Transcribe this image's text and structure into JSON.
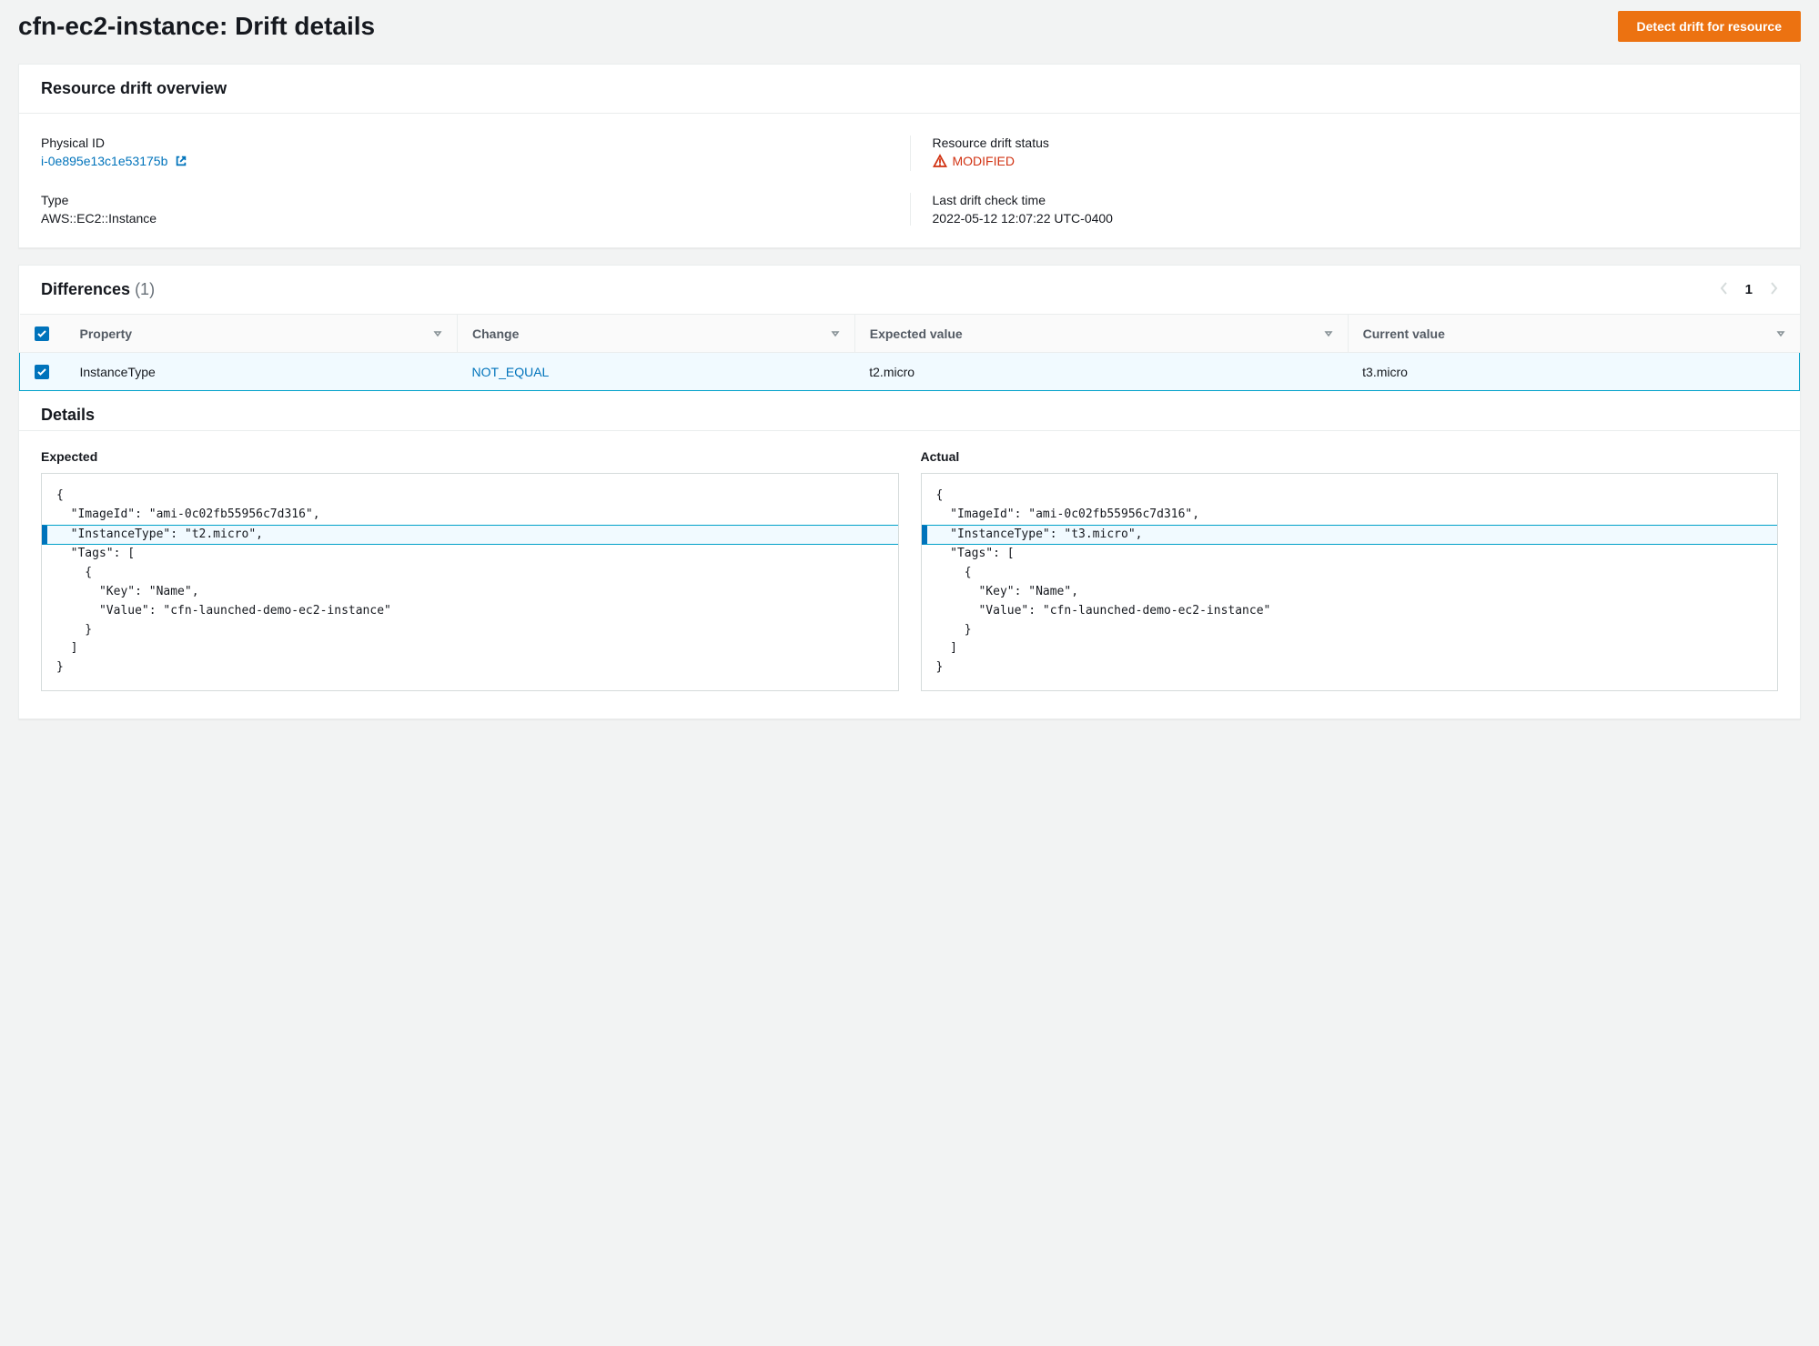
{
  "header": {
    "title": "cfn-ec2-instance: Drift details",
    "detect_button": "Detect drift for resource"
  },
  "overview": {
    "section_title": "Resource drift overview",
    "physical_id_label": "Physical ID",
    "physical_id_value": "i-0e895e13c1e53175b",
    "drift_status_label": "Resource drift status",
    "drift_status_value": "MODIFIED",
    "type_label": "Type",
    "type_value": "AWS::EC2::Instance",
    "last_check_label": "Last drift check time",
    "last_check_value": "2022-05-12 12:07:22 UTC-0400"
  },
  "differences": {
    "section_title": "Differences",
    "count": "(1)",
    "pager_page": "1",
    "columns": {
      "property": "Property",
      "change": "Change",
      "expected": "Expected value",
      "current": "Current value"
    },
    "rows": [
      {
        "property": "InstanceType",
        "change": "NOT_EQUAL",
        "expected": "t2.micro",
        "current": "t3.micro"
      }
    ]
  },
  "details": {
    "section_title": "Details",
    "expected_label": "Expected",
    "actual_label": "Actual",
    "expected_lines": [
      "{",
      "  \"ImageId\": \"ami-0c02fb55956c7d316\",",
      "  \"InstanceType\": \"t2.micro\",",
      "  \"Tags\": [",
      "    {",
      "      \"Key\": \"Name\",",
      "      \"Value\": \"cfn-launched-demo-ec2-instance\"",
      "    }",
      "  ]",
      "}"
    ],
    "actual_lines": [
      "{",
      "  \"ImageId\": \"ami-0c02fb55956c7d316\",",
      "  \"InstanceType\": \"t3.micro\",",
      "  \"Tags\": [",
      "    {",
      "      \"Key\": \"Name\",",
      "      \"Value\": \"cfn-launched-demo-ec2-instance\"",
      "    }",
      "  ]",
      "}"
    ],
    "highlight_index": 2
  }
}
